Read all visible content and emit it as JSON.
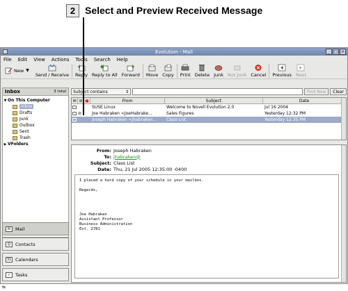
{
  "caption": {
    "step": "2",
    "text": "Select and Preview Received Message"
  },
  "window": {
    "title": "Evolution - Mail",
    "controls": [
      "_",
      "□",
      "×"
    ]
  },
  "menubar": [
    {
      "key": "file",
      "label": "File"
    },
    {
      "key": "edit",
      "label": "Edit"
    },
    {
      "key": "view",
      "label": "View"
    },
    {
      "key": "actions",
      "label": "Actions"
    },
    {
      "key": "tools",
      "label": "Tools"
    },
    {
      "key": "search",
      "label": "Search"
    },
    {
      "key": "help",
      "label": "Help"
    }
  ],
  "toolbar": {
    "new": "New",
    "send_receive": "Send / Receive",
    "reply": "Reply",
    "reply_all": "Reply to All",
    "forward": "Forward",
    "move": "Move",
    "copy": "Copy",
    "print": "Print",
    "delete": "Delete",
    "junk": "Junk",
    "not_junk": "Not Junk",
    "cancel": "Cancel",
    "previous": "Previous",
    "next": "Next"
  },
  "sidebar": {
    "folder_title": "Inbox",
    "folder_count": "3 total",
    "tree": [
      {
        "label": "On This Computer",
        "level": 0,
        "bold": true,
        "arrow": "▼"
      },
      {
        "label": "Inbox",
        "level": 1,
        "selected": true
      },
      {
        "label": "Drafts",
        "level": 1
      },
      {
        "label": "Junk",
        "level": 1
      },
      {
        "label": "Outbox",
        "level": 1
      },
      {
        "label": "Sent",
        "level": 1
      },
      {
        "label": "Trash",
        "level": 1
      },
      {
        "label": "VFolders",
        "level": 0,
        "bold": true,
        "arrow": "▶"
      }
    ],
    "switcher": [
      {
        "label": "Mail",
        "active": true
      },
      {
        "label": "Contacts"
      },
      {
        "label": "Calendars"
      },
      {
        "label": "Tasks"
      }
    ]
  },
  "search": {
    "scope": "Subject contains",
    "value": "",
    "find_now": "Find Now",
    "clear": "Clear"
  },
  "message_list": {
    "columns": {
      "from": "From",
      "subject": "Subject",
      "date": "Date"
    },
    "rows": [
      {
        "from": "SUSE Linux",
        "subject": "Welcome to Novell Evolution 2.0",
        "date": "Jul 16 2004",
        "attachment": false,
        "selected": false
      },
      {
        "from": "Joe Habraken <JoeHabrake...",
        "subject": "Sales Figures",
        "date": "Yesterday 12:32 PM",
        "attachment": true,
        "selected": false
      },
      {
        "from": "Joseph Habraken <jhabraken...",
        "subject": "Class List",
        "date": "Yesterday 12:35 PM",
        "attachment": false,
        "selected": true
      }
    ]
  },
  "preview": {
    "labels": {
      "from": "From:",
      "to": "To:",
      "subject": "Subject:",
      "date": "Date:"
    },
    "from": "Joseph Habraken",
    "to": "jhabraken@",
    "subject": "Class List",
    "date": "Thu, 21 Jul 2005 12:35:00 -0400",
    "body": "I placed a hard copy of your schedule in your mailbox.\n\nRegards,\n\n\n\n\nJoe Habraken\nAssistant Professor\nBusiness Administration\nExt. 2781"
  }
}
